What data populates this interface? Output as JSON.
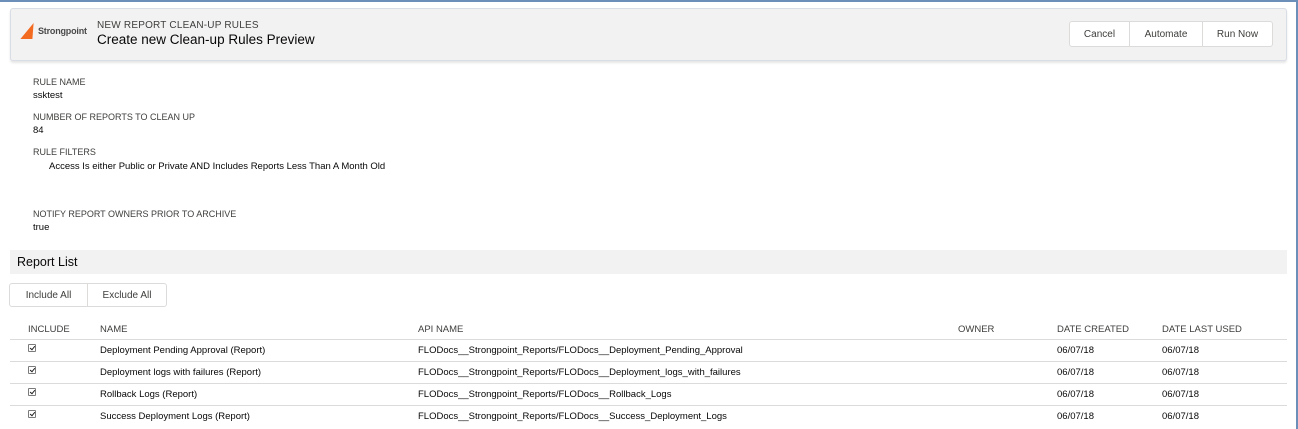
{
  "header": {
    "logo_text": "Strongpoint",
    "eyebrow": "NEW REPORT CLEAN-UP RULES",
    "title": "Create new Clean-up Rules Preview",
    "buttons": {
      "cancel": "Cancel",
      "automate": "Automate",
      "run_now": "Run Now"
    }
  },
  "details": {
    "rule_name_label": "RULE NAME",
    "rule_name_value": "ssktest",
    "count_label": "NUMBER OF REPORTS TO CLEAN UP",
    "count_value": "84",
    "filters_label": "RULE FILTERS",
    "filters_value": "Access Is either Public or Private AND Includes Reports Less Than A Month Old",
    "notify_label": "NOTIFY REPORT OWNERS PRIOR TO ARCHIVE",
    "notify_value": "true"
  },
  "report_list": {
    "title": "Report List",
    "include_all": "Include All",
    "exclude_all": "Exclude All",
    "columns": {
      "include": "INCLUDE",
      "name": "NAME",
      "api_name": "API NAME",
      "owner": "OWNER",
      "date_created": "DATE CREATED",
      "date_last_used": "DATE LAST USED"
    },
    "rows": [
      {
        "included": true,
        "name": "Deployment Pending Approval (Report)",
        "api_name": "FLODocs__Strongpoint_Reports/FLODocs__Deployment_Pending_Approval",
        "owner": "",
        "date_created": "06/07/18",
        "date_last_used": "06/07/18"
      },
      {
        "included": true,
        "name": "Deployment logs with failures (Report)",
        "api_name": "FLODocs__Strongpoint_Reports/FLODocs__Deployment_logs_with_failures",
        "owner": "",
        "date_created": "06/07/18",
        "date_last_used": "06/07/18"
      },
      {
        "included": true,
        "name": "Rollback Logs (Report)",
        "api_name": "FLODocs__Strongpoint_Reports/FLODocs__Rollback_Logs",
        "owner": "",
        "date_created": "06/07/18",
        "date_last_used": "06/07/18"
      },
      {
        "included": true,
        "name": "Success Deployment Logs (Report)",
        "api_name": "FLODocs__Strongpoint_Reports/FLODocs__Success_Deployment_Logs",
        "owner": "",
        "date_created": "06/07/18",
        "date_last_used": "06/07/18"
      }
    ]
  },
  "colors": {
    "accent_orange": "#f26b21",
    "header_bg": "#f3f2f2",
    "border": "#dddbda"
  }
}
